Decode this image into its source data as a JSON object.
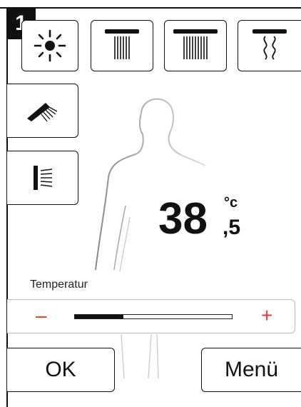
{
  "badge": {
    "number": "1"
  },
  "mode_buttons": [
    {
      "name": "light-icon"
    },
    {
      "name": "narrow-rain-shower-icon"
    },
    {
      "name": "wide-rain-shower-icon"
    },
    {
      "name": "massage-shower-icon"
    },
    {
      "name": "hand-shower-icon"
    },
    {
      "name": "side-shower-icon"
    }
  ],
  "temperature": {
    "integer": "38",
    "decimal": ",5",
    "unit": "°c"
  },
  "slider": {
    "label": "Temperatur",
    "minus": "–",
    "plus": "+",
    "level": 0.31,
    "accent": "#e23a2b"
  },
  "buttons": {
    "ok": "OK",
    "menu": "Menü"
  }
}
